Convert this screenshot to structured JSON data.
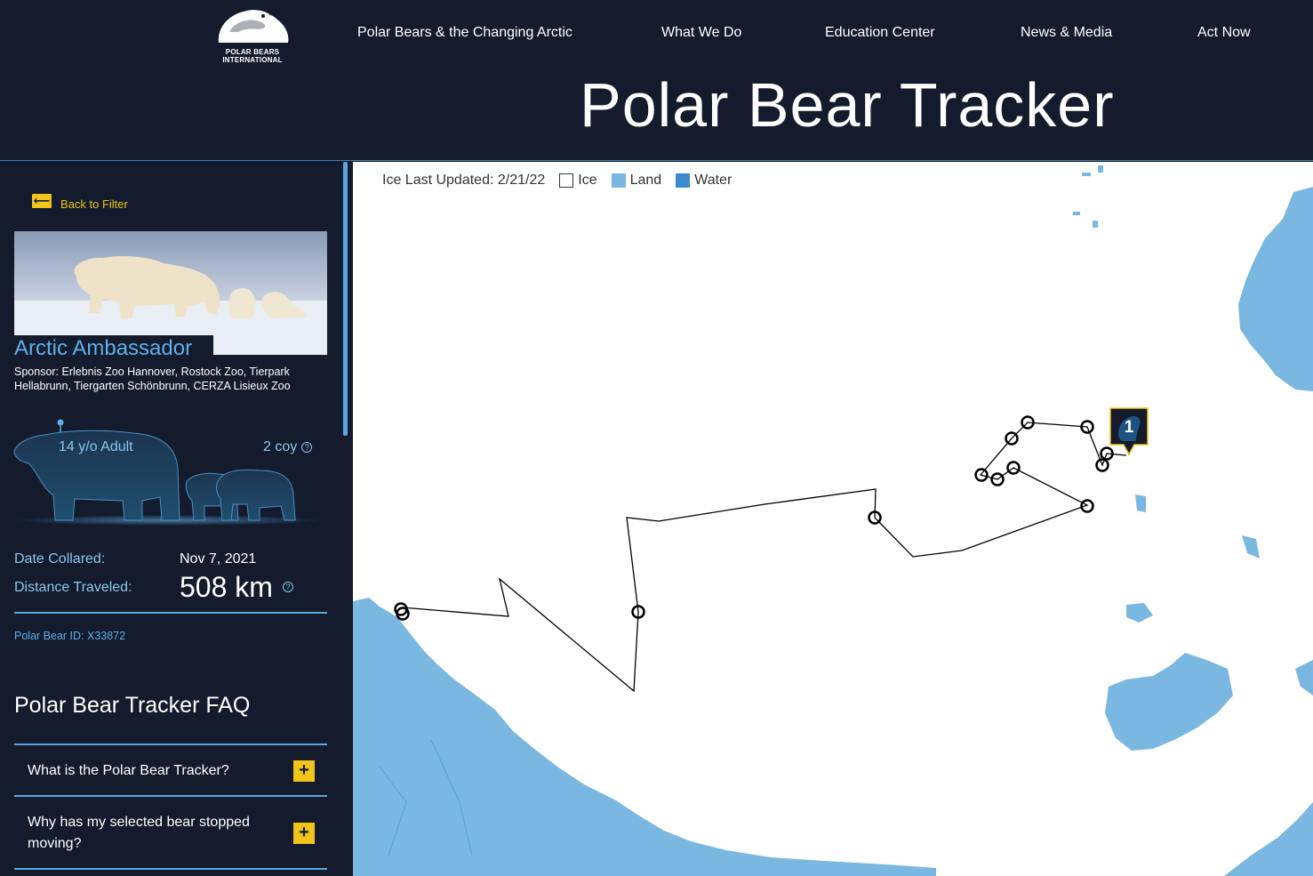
{
  "header": {
    "logo_text": [
      "POLAR BEARS",
      "INTERNATIONAL"
    ],
    "title": "Polar Bear Tracker",
    "nav": [
      {
        "label": "Polar Bears & the Changing Arctic"
      },
      {
        "label": "What We Do"
      },
      {
        "label": "Education Center"
      },
      {
        "label": "News & Media"
      },
      {
        "label": "Act Now"
      }
    ]
  },
  "sidebar": {
    "back_label": "Back to Filter",
    "bear_name": "Arctic Ambassador",
    "sponsor": "Sponsor: Erlebnis Zoo Hannover, Rostock Zoo, Tierpark Hellabrunn, Tiergarten Schönbrunn, CERZA Lisieux Zoo",
    "age": "14 y/o Adult",
    "cubs": "2 coy",
    "help_glyph": "?",
    "date_collared_label": "Date Collared:",
    "date_collared_value": "Nov 7, 2021",
    "distance_label": "Distance Traveled:",
    "distance_value": "508 km",
    "bear_id": "Polar Bear ID: X33872",
    "faq_title": "Polar Bear Tracker FAQ",
    "faq": [
      {
        "question": "What is the Polar Bear Tracker?",
        "icon": "+"
      },
      {
        "question": "Why has my selected bear stopped moving?",
        "icon": "+"
      }
    ]
  },
  "map": {
    "legend_prefix": "Ice Last Updated: 2/21/22",
    "legend": [
      {
        "label": "Ice",
        "color": "#ffffff"
      },
      {
        "label": "Land",
        "color": "#7ab8e2"
      },
      {
        "label": "Water",
        "color": "#3c8ad0"
      }
    ],
    "marker_label": "1",
    "marker_icon": "bear-marker-icon"
  },
  "colors": {
    "background": "#131b2c",
    "accent_blue": "#5fb0ea",
    "accent_yellow": "#f0c419",
    "land": "#7ab8e2",
    "water": "#3c8ad0"
  }
}
